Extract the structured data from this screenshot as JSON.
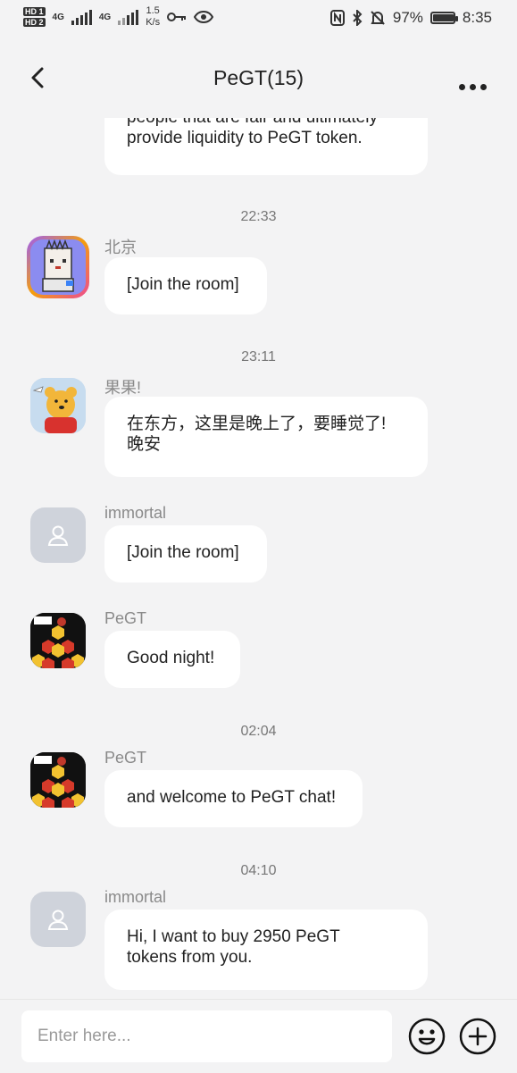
{
  "status_bar": {
    "hd1": "HD 1",
    "hd2": "HD 2",
    "net1": "4G",
    "net2": "4G",
    "speed_value": "1.5",
    "speed_unit": "K/s",
    "battery_text": "97%",
    "battery_level": 0.97,
    "time": "8:35"
  },
  "header": {
    "title": "PeGT(15)"
  },
  "chat": {
    "partial_message": "people that are fair and ultimately\nprovide liquidity to PeGT token.",
    "timestamps": [
      "22:33",
      "23:11",
      "02:04",
      "04:10"
    ],
    "messages": [
      {
        "sender": "北京",
        "text": "[Join the room]"
      },
      {
        "sender": "果果!",
        "text": "在东方，这里是晚上了，要睡觉了!\n晚安"
      },
      {
        "sender": "immortal",
        "text": "[Join the room]"
      },
      {
        "sender": "PeGT",
        "text": "Good night!"
      },
      {
        "sender": "PeGT",
        "text": "and welcome to PeGT chat!"
      },
      {
        "sender": "immortal",
        "text": "Hi, I want  to buy 2950 PeGT\ntokens from you."
      }
    ]
  },
  "input_bar": {
    "placeholder": "Enter here..."
  },
  "icons": {
    "back": "chevron-left-icon",
    "more": "more-dots-icon",
    "emoji": "smiley-face-icon",
    "add": "plus-circle-icon",
    "key": "key-icon",
    "eye": "eye-icon",
    "nfc": "nfc-icon",
    "bluetooth": "bluetooth-icon",
    "mute": "bell-off-icon"
  }
}
